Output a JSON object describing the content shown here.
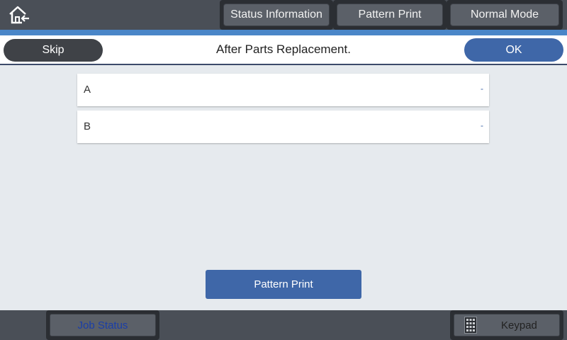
{
  "topbar": {
    "home_icon": "home-back-icon",
    "buttons": [
      "Status Information",
      "Pattern Print",
      "Normal Mode"
    ]
  },
  "header": {
    "skip_label": "Skip",
    "title": "After Parts Replacement.",
    "ok_label": "OK"
  },
  "list": [
    {
      "label": "A",
      "value": "-"
    },
    {
      "label": "B",
      "value": "-"
    }
  ],
  "main": {
    "pattern_print_label": "Pattern Print"
  },
  "bottombar": {
    "job_status_label": "Job Status",
    "keypad_label": "Keypad",
    "keypad_icon": "keypad-icon"
  },
  "colors": {
    "accent": "#3f67a8",
    "strip": "#4a86c8",
    "bar": "#4a4f57",
    "background": "#e6eaee",
    "link": "#1a3ea8"
  }
}
